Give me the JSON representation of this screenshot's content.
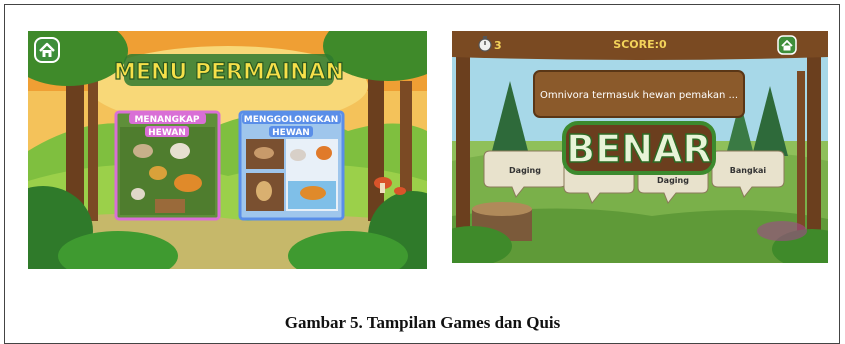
{
  "figure": {
    "caption": "Gambar 5. Tampilan Games dan Quis"
  },
  "menu_screen": {
    "title": "MENU PERMAINAN",
    "home_icon": "home-icon",
    "cards": [
      {
        "line1": "MENANGKAP",
        "line2": "HEWAN"
      },
      {
        "line1": "MENGGOLONGKAN",
        "line2": "HEWAN"
      }
    ],
    "colors": {
      "title_fill": "#f7e04a",
      "title_stroke": "#2f7a2f",
      "card1_border": "#d96fd6",
      "card2_border": "#5a8ee8"
    }
  },
  "quiz_screen": {
    "timer_value": "3",
    "timer_icon": "stopwatch-icon",
    "score_label": "SCORE:0",
    "home_icon": "home-icon",
    "question": "Omnivora termasuk hewan pemakan ...",
    "feedback": "BENAR",
    "answers": [
      "Daging",
      "",
      "Daging",
      "Bangkai"
    ],
    "colors": {
      "top_bar": "#7a4a22",
      "question_box": "#8b5a2b",
      "feedback_fill": "#6b3e1e",
      "feedback_stroke": "#3c8a2e"
    }
  }
}
